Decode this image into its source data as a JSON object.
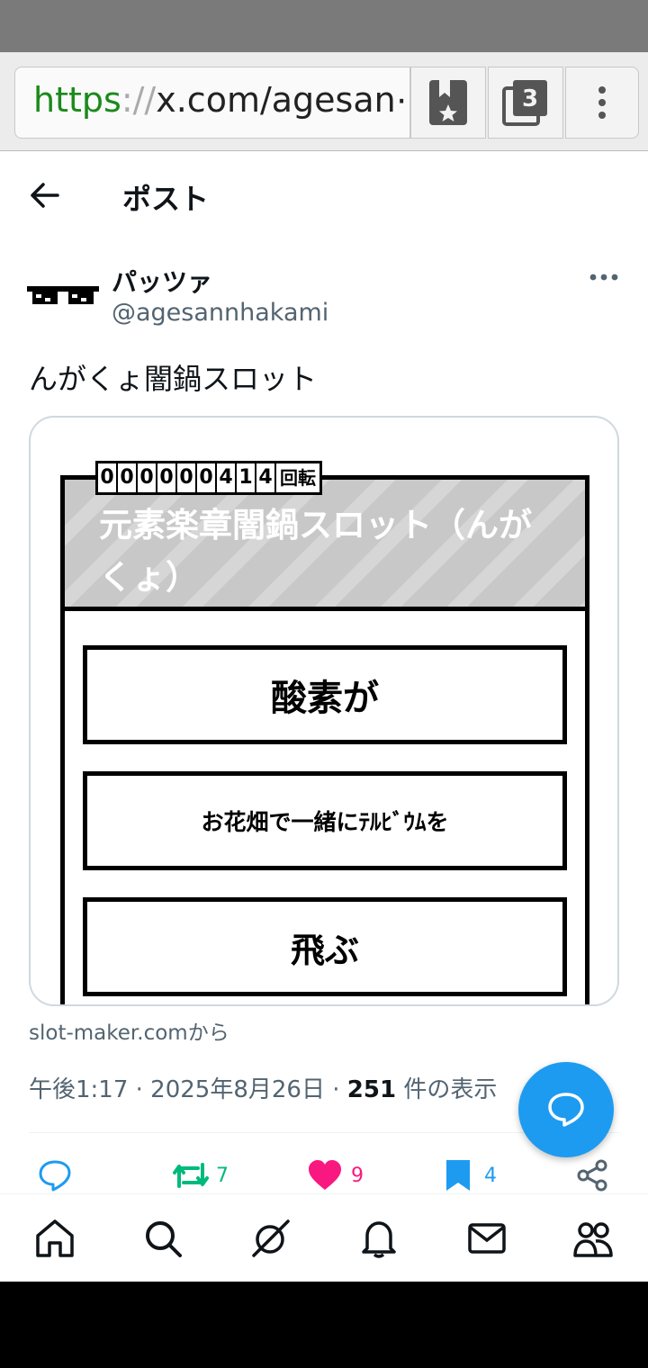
{
  "browser": {
    "url_scheme": "https",
    "url_sep": "://",
    "url_rest": "x.com/agesan⋯",
    "tab_count": "3",
    "bookmark_icon": "bookmark-star-icon",
    "tabs_icon": "tabs-icon",
    "menu_icon": "kebab-menu-icon"
  },
  "header": {
    "title": "ポスト",
    "back_icon": "arrow-left-icon"
  },
  "post": {
    "display_name": "パッツァ",
    "handle": "@agesannhakami",
    "text": "んがくょ闇鍋スロット",
    "source": "slot-maker.comから",
    "time": "午後1:17 · 2025年8月26日 · ",
    "views_count": "251",
    "views_label": " 件の表示"
  },
  "slot": {
    "counter_digits": [
      "0",
      "0",
      "0",
      "0",
      "0",
      "0",
      "4",
      "1",
      "4"
    ],
    "counter_unit": "回転",
    "title": "元素楽章闇鍋スロット（んがくょ）",
    "reels": [
      "酸素が",
      "お花畑で一緒にﾃﾙﾋﾞｳﾑを",
      "飛ぶ"
    ]
  },
  "actions": {
    "reply_count": "",
    "retweet_count": "7",
    "like_count": "9",
    "bookmark_count": "4"
  },
  "colors": {
    "accent": "#1d9bf0",
    "retweet": "#00ba7c",
    "like": "#f91880",
    "url_scheme": "#1a8a1a"
  },
  "nav": [
    "home-icon",
    "search-icon",
    "grok-icon",
    "notifications-icon",
    "messages-icon",
    "communities-icon"
  ]
}
